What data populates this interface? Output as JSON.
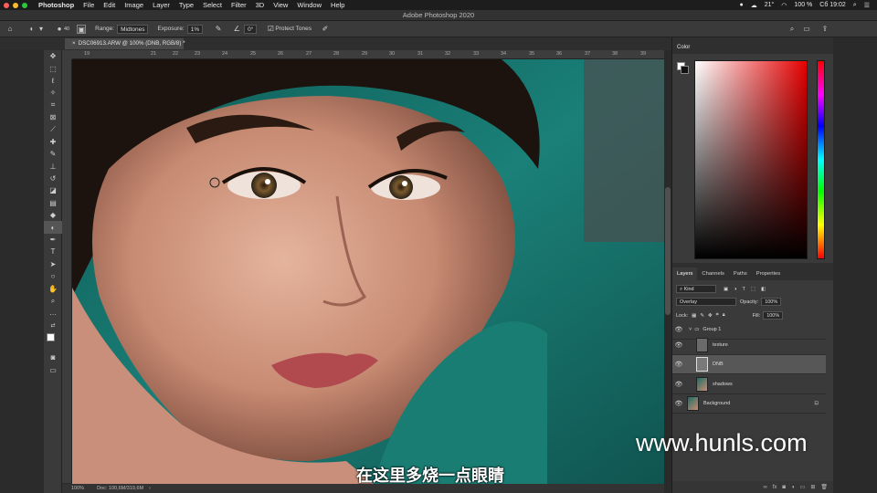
{
  "menubar": {
    "app_name": "Photoshop",
    "items": [
      "File",
      "Edit",
      "Image",
      "Layer",
      "Type",
      "Select",
      "Filter",
      "3D",
      "View",
      "Window",
      "Help"
    ],
    "battery": "100 %",
    "clock": "Сб 19:02",
    "temp": "21°"
  },
  "window": {
    "title": "Adobe Photoshop 2020"
  },
  "options_bar": {
    "brush_size": "40",
    "range_label": "Range:",
    "range_value": "Midtones",
    "exposure_label": "Exposure:",
    "exposure_value": "1%",
    "angle_value": "0°",
    "protect_tones_label": "Protect Tones"
  },
  "document": {
    "tab_title": "DSC06913.ARW @ 100% (DNB, RGB/8) *",
    "zoom": "100%",
    "doc_size": "Doc: 100,6M/319,6M"
  },
  "ruler": {
    "h_ticks": [
      "19",
      "21",
      "22",
      "23",
      "24",
      "25",
      "26",
      "27",
      "28",
      "29",
      "30",
      "31",
      "32",
      "33",
      "34",
      "35",
      "36",
      "37",
      "38",
      "39"
    ]
  },
  "panels": {
    "color_title": "Color",
    "layer_tabs": [
      "Layers",
      "Channels",
      "Paths",
      "Properties"
    ],
    "filter_kind": "Kind",
    "blend_mode": "Overlay",
    "opacity_label": "Opacity:",
    "opacity_value": "100%",
    "lock_label": "Lock:",
    "fill_label": "Fill:",
    "fill_value": "100%",
    "layers": [
      {
        "name": "Group 1"
      },
      {
        "name": "texture"
      },
      {
        "name": "DNB"
      },
      {
        "name": "shadows"
      },
      {
        "name": "Background"
      }
    ]
  },
  "overlay": {
    "watermark": "www.hunls.com",
    "subtitle": "在这里多烧一点眼睛"
  },
  "colors": {
    "ui_dark": "#2b2b2b",
    "panel": "#3a3a3a",
    "selected_layer": "#575757",
    "teal_background": "#1f7a73"
  },
  "icons": {
    "tools": [
      "move-icon",
      "marquee-icon",
      "lasso-icon",
      "quick-select-icon",
      "crop-icon",
      "frame-icon",
      "eyedropper-icon",
      "healing-icon",
      "brush-icon",
      "clone-stamp-icon",
      "history-brush-icon",
      "eraser-icon",
      "gradient-icon",
      "blur-icon",
      "dodge-burn-icon",
      "pen-icon",
      "type-icon",
      "path-select-icon",
      "shape-icon",
      "hand-icon",
      "zoom-icon",
      "more-tools-icon"
    ]
  }
}
